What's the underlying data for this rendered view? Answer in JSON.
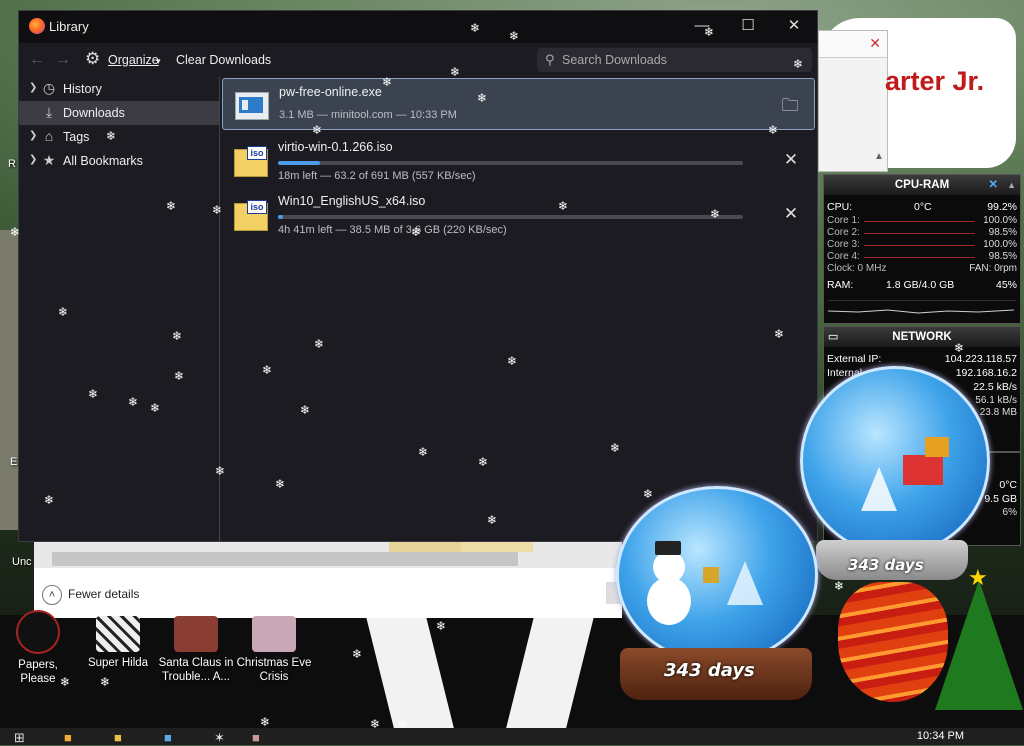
{
  "library": {
    "title": "Library",
    "toolbar": {
      "organize": "Organize",
      "clear_downloads": "Clear Downloads",
      "search_placeholder": "Search Downloads"
    },
    "sidebar": [
      {
        "label": "History",
        "icon": "clock-icon",
        "twisty": true,
        "selected": false
      },
      {
        "label": "Downloads",
        "icon": "download-icon",
        "twisty": false,
        "selected": true
      },
      {
        "label": "Tags",
        "icon": "tag-icon",
        "twisty": true,
        "selected": false
      },
      {
        "label": "All Bookmarks",
        "icon": "star-icon",
        "twisty": true,
        "selected": false
      }
    ],
    "downloads": [
      {
        "name": "pw-free-online.exe",
        "info": "3.1 MB — minitool.com — 10:33 PM",
        "type": "exe",
        "action": "folder-icon",
        "selected": true
      },
      {
        "name": "virtio-win-0.1.266.iso",
        "info": "18m left — 63.2 of 691 MB (557 KB/sec)",
        "type": "iso",
        "progress": 0.09,
        "action": "close-icon"
      },
      {
        "name": "Win10_EnglishUS_x64.iso",
        "info": "4h 41m left — 38.5 MB of 3.6 GB (220 KB/sec)",
        "type": "iso",
        "progress": 0.01,
        "action": "close-icon"
      }
    ]
  },
  "details_window": {
    "fewer_details": "Fewer details"
  },
  "background_window": {
    "bubble_text": "arter Jr."
  },
  "gadgets": {
    "cpu_ram": {
      "title": "CPU-RAM",
      "cpu_label": "CPU:",
      "cpu_temp": "0°C",
      "cpu_value": "99.2%",
      "cores": [
        {
          "label": "Core 1:",
          "value": "100.0%"
        },
        {
          "label": "Core 2:",
          "value": "98.5%"
        },
        {
          "label": "Core 3:",
          "value": "100.0%"
        },
        {
          "label": "Core 4:",
          "value": "98.5%"
        }
      ],
      "clock": "Clock: 0 MHz",
      "fan": "FAN: 0rpm",
      "ram_label": "RAM:",
      "ram_value": "1.8 GB/4.0 GB",
      "ram_percent": "45%"
    },
    "network": {
      "title": "NETWORK",
      "external_label": "External IP:",
      "external_ip": "104.223.118.57",
      "internal_label": "Internal",
      "internal_ip": "192.168.16.2",
      "rate1": "22.5 kB/s",
      "rate2": "56.1 kB/s",
      "rate3": "23.8 MB"
    },
    "small": {
      "temp": "0°C",
      "value": "9.5 GB",
      "pct": "6%"
    }
  },
  "globes": {
    "left_days": "343 days",
    "right_days": "343 days"
  },
  "desktop_icons": [
    {
      "label": "Papers, Please"
    },
    {
      "label": "Super Hilda"
    },
    {
      "label": "Santa Claus in Trouble... A..."
    },
    {
      "label": "Christmas Eve Crisis"
    }
  ],
  "desktop_fragments": {
    "r": "R",
    "e": "E",
    "unc": "Unc"
  },
  "taskbar": {
    "clock": "10:34 PM"
  },
  "colors": {
    "accent": "#4c9be8",
    "window_bg": "#1c1b22",
    "selected_row": "#3b4350"
  }
}
